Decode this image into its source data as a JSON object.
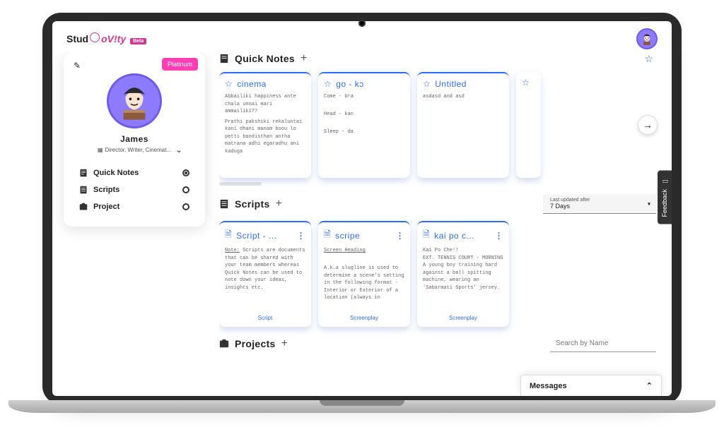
{
  "brand": {
    "part1": "Stud",
    "part2": "oV!ty",
    "beta": "Beta"
  },
  "user": {
    "name": "James",
    "roles": "Director, Writer, Cinemat...",
    "plan": "Platinum"
  },
  "nav": [
    {
      "label": "Quick Notes",
      "icon": "note",
      "active": true
    },
    {
      "label": "Scripts",
      "icon": "script",
      "active": false
    },
    {
      "label": "Project",
      "icon": "project",
      "active": false
    }
  ],
  "sections": {
    "quickNotes": {
      "title": "Quick Notes",
      "cards": [
        {
          "title": "cinema",
          "body": [
            "Abbailiki happiness ante chala unnai mari ammailiki??",
            "",
            "Prathi pakshiki rekaluntai kani dhani manam boou lo petti bandisthan antha matrana adhi egaradhu ani kaduga"
          ]
        },
        {
          "title": "go - kɔ",
          "body": [
            "Come - bra",
            "",
            "Head - kan",
            "",
            "Sleep - da"
          ]
        },
        {
          "title": "Untitled",
          "body": [
            "asdasd and asd"
          ]
        }
      ]
    },
    "scripts": {
      "title": "Scripts",
      "filter": {
        "label": "Last updated after",
        "value": "7 Days"
      },
      "cards": [
        {
          "title": "Script - ...",
          "body_label": "Note:",
          "body": " Scripts are documents that can be shared with your team members whereas Quick Notes can be used to note down your ideas, insights etc.",
          "foot": "Script"
        },
        {
          "title": "scripe",
          "body_heading": "Screen Heading",
          "body": "A.k.a slugline is used to determine a scene's setting in the following format - Interior or Exterior of a location (always in",
          "foot": "Screenplay"
        },
        {
          "title": "kai po c...",
          "body": "Kai Po Che!!\nEXT. TENNIS COURT - MORNING\nA young boy training hard against a ball spitting machine, wearing an 'Sabarmati Sports' jersey.",
          "foot": "Screenplay"
        }
      ]
    },
    "projects": {
      "title": "Projects",
      "search_placeholder": "Search by Name"
    }
  },
  "messages_label": "Messages",
  "feedback_label": "Feedback"
}
